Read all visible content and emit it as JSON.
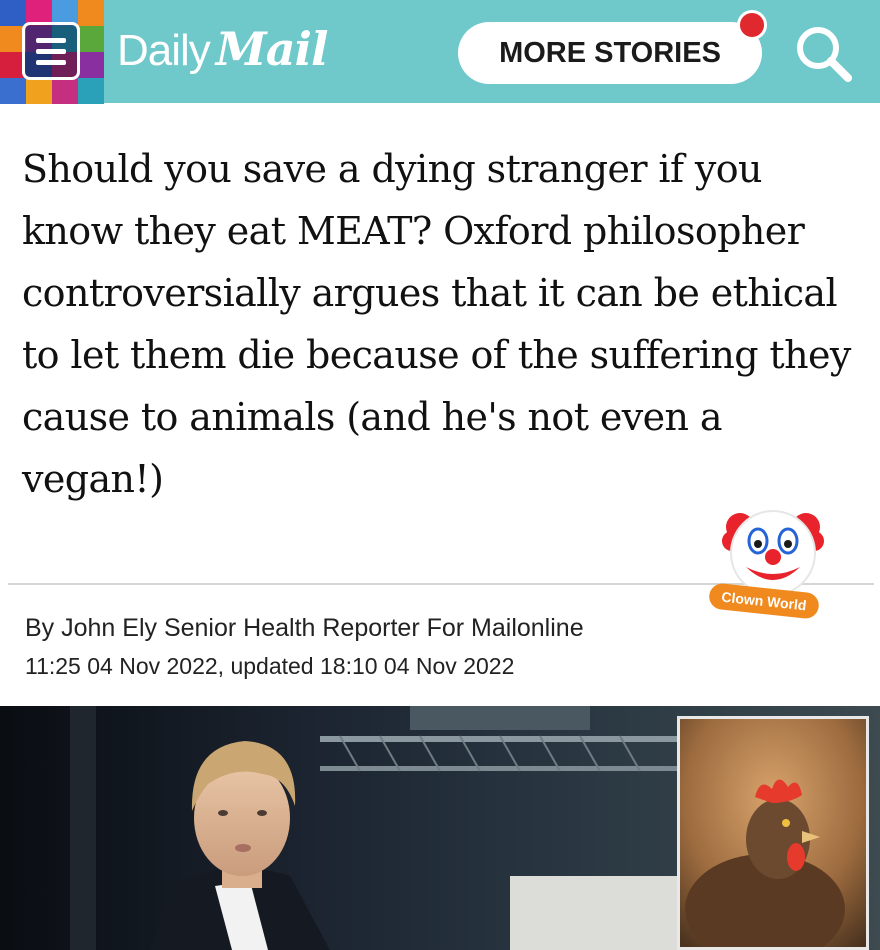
{
  "header": {
    "brand_daily": "Daily",
    "brand_mail": "Mail",
    "more_stories_label": "MORE STORIES",
    "background_color": "#6fc8c9",
    "notification_color": "#e0282f",
    "mosaic_colors": [
      "#2f5fc4",
      "#e0217b",
      "#4a9be0",
      "#f08a1e",
      "#f08a1e",
      "#9b2fae",
      "#1fb0c8",
      "#5aa83c",
      "#d61f3c",
      "#2f4fb5",
      "#e0217b",
      "#8a2fa0",
      "#3a6fd0",
      "#f0a21e",
      "#c4307f",
      "#2aa1b8"
    ],
    "menu_icon": "hamburger-menu-icon",
    "search_icon": "search-icon"
  },
  "article": {
    "headline": "Should you save a dying stranger if you know they eat MEAT? Oxford philosopher controversially argues that it can be ethical to let them die because of the suffering they cause to animals (and he's not even a vegan!)",
    "byline": "By John Ely Senior Health Reporter For Mailonline",
    "dates": "11:25 04 Nov 2022, updated 18:10 04 Nov 2022"
  },
  "sticker": {
    "icon": "clown-face-icon",
    "label": "Clown World",
    "label_color": "#f08a1e"
  },
  "photo": {
    "main": "man-speaking-on-stage-photo",
    "inset": "chicken-photo"
  }
}
